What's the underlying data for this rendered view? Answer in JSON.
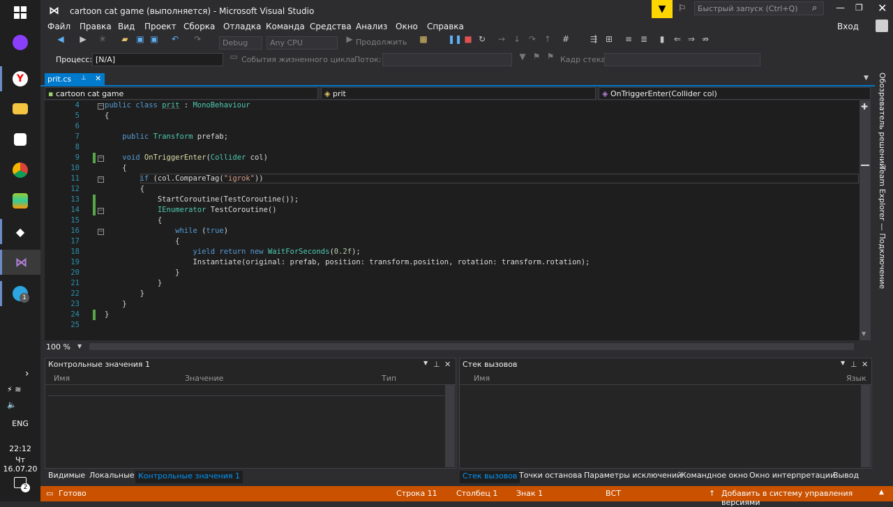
{
  "window": {
    "title": "cartoon cat game (выполняется) - Microsoft Visual Studio",
    "quick_launch_placeholder": "Быстрый запуск (Ctrl+Q)",
    "sign_in": "Вход"
  },
  "menu": [
    "Файл",
    "Правка",
    "Вид",
    "Проект",
    "Сборка",
    "Отладка",
    "Команда",
    "Средства",
    "Анализ",
    "Окно",
    "Справка"
  ],
  "toolbar": {
    "config": "Debug",
    "platform": "Any CPU",
    "continue_label": "Продолжить",
    "process_label": "Процесс:",
    "process_value": "[N/A]",
    "lifecycle_label": "События жизненного цикла",
    "thread_label": "Поток:",
    "stack_frame_label": "Кадр стека:"
  },
  "editor": {
    "tab": "prit.cs",
    "nav_project": "cartoon cat game",
    "nav_class": "prit",
    "nav_member": "OnTriggerEnter(Collider col)",
    "zoom": "100 %",
    "line_numbers": [
      "4",
      "5",
      "6",
      "7",
      "8",
      "9",
      "10",
      "11",
      "12",
      "13",
      "14",
      "15",
      "16",
      "17",
      "18",
      "19",
      "20",
      "21",
      "22",
      "23",
      "24",
      "25"
    ]
  },
  "side_panels": {
    "solution_explorer": "Обозреватель решений",
    "team_explorer": "Team Explorer — Подключение"
  },
  "watch": {
    "title": "Контрольные значения 1",
    "columns": [
      "Имя",
      "Значение",
      "Тип"
    ]
  },
  "callstack": {
    "title": "Стек вызовов",
    "columns": [
      "Имя",
      "Язык"
    ]
  },
  "bottom_tabs_left": [
    "Видимые",
    "Локальные",
    "Контрольные значения 1"
  ],
  "bottom_tabs_right": [
    "Стек вызовов",
    "Точки останова",
    "Параметры исключений",
    "Командное окно",
    "Окно интерпретации",
    "Вывод"
  ],
  "status": {
    "ready": "Готово",
    "line": "Строка 11",
    "col": "Столбец 1",
    "char": "Знак 1",
    "ins": "ВСТ",
    "source_control": "Добавить в систему управления версиями"
  },
  "taskbar": {
    "lang": "ENG",
    "time": "22:12",
    "date": "Чт 16.07.20",
    "telegram_badge": "1",
    "notif_badge": "2"
  },
  "colors": {
    "accent": "#007acc",
    "status": "#ca5100",
    "keyword": "#569cd6",
    "type": "#4ec9b0",
    "string": "#d69d85"
  }
}
